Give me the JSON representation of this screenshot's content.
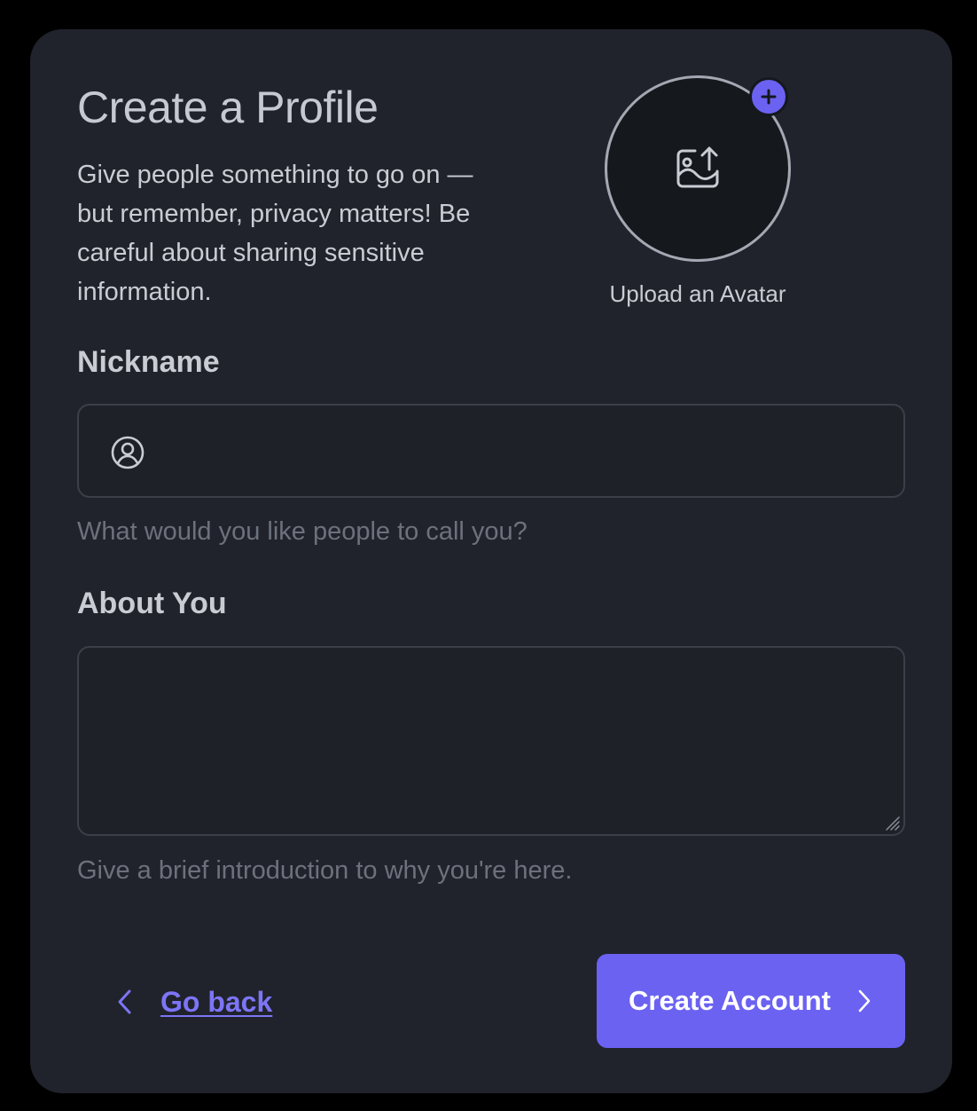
{
  "header": {
    "title": "Create a Profile",
    "intro": "Give people something to go on — but remember, privacy matters! Be careful about sharing sensitive information."
  },
  "avatar": {
    "caption": "Upload an Avatar",
    "icon": "image-upload-icon",
    "badge_icon": "plus-icon"
  },
  "nickname": {
    "label": "Nickname",
    "value": "",
    "placeholder": "",
    "icon": "user-circle-icon",
    "hint": "What would you like people to call you?"
  },
  "about": {
    "label": "About You",
    "value": "",
    "placeholder": "",
    "hint": "Give a brief introduction to why you're here."
  },
  "actions": {
    "back_label": "Go back",
    "back_icon": "chevron-left-icon",
    "submit_label": "Create Account",
    "submit_icon": "chevron-right-icon"
  },
  "colors": {
    "background": "#000000",
    "card": "#20232b",
    "accent": "#6b62f2",
    "link": "#7d75f6",
    "text": "#c9ccd3",
    "muted": "#6c717c"
  }
}
